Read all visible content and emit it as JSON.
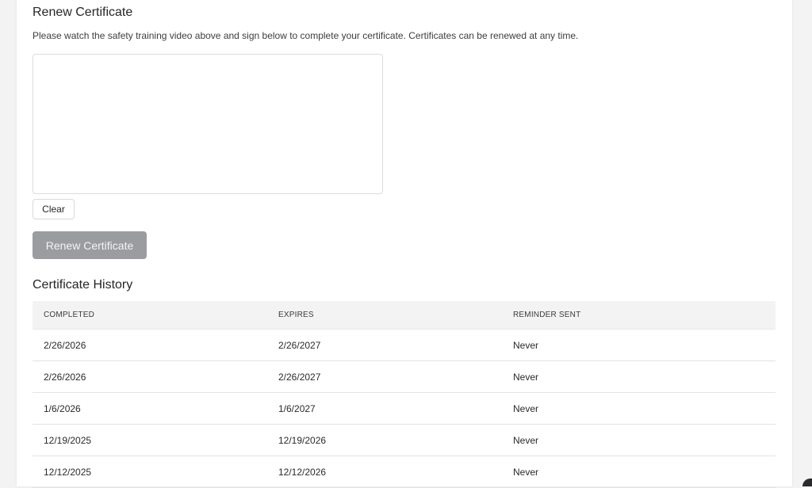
{
  "renew": {
    "title": "Renew Certificate",
    "description": "Please watch the safety training video above and sign below to complete your certificate. Certificates can be renewed at any time.",
    "clear_label": "Clear",
    "submit_label": "Renew Certificate"
  },
  "history": {
    "title": "Certificate History",
    "columns": [
      "COMPLETED",
      "EXPIRES",
      "REMINDER SENT"
    ],
    "rows": [
      [
        "2/26/2026",
        "2/26/2027",
        "Never"
      ],
      [
        "2/26/2026",
        "2/26/2027",
        "Never"
      ],
      [
        "1/6/2026",
        "1/6/2027",
        "Never"
      ],
      [
        "12/19/2025",
        "12/19/2026",
        "Never"
      ],
      [
        "12/12/2025",
        "12/12/2026",
        "Never"
      ]
    ]
  },
  "colors": {
    "disabled_button": "#9b9ca0",
    "table_header_bg": "#f3f3f4",
    "page_bg": "#f3f3f4"
  }
}
